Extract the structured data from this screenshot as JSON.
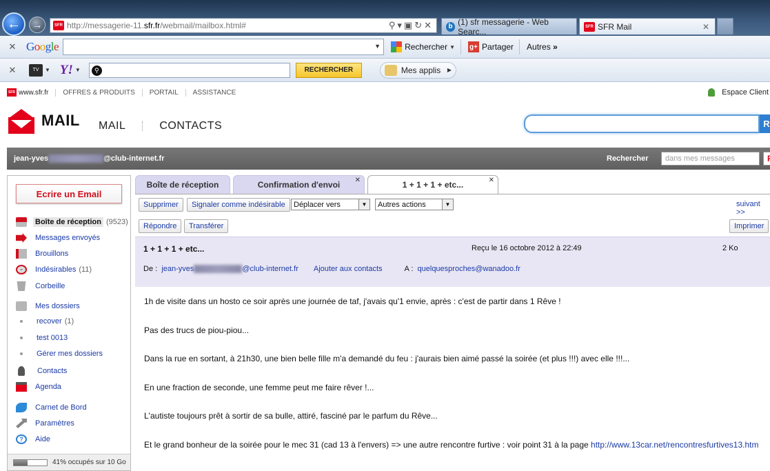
{
  "browser": {
    "url_prefix": "http://messagerie-11.",
    "url_domain": "sfr.fr",
    "url_suffix": "/webmail/mailbox.html#",
    "favicon_text": "SFR",
    "tabs": [
      {
        "label": "(1) sfr messagerie - Web Searc..."
      },
      {
        "label": "SFR Mail"
      }
    ]
  },
  "toolbar1": {
    "google_logo": [
      "G",
      "o",
      "o",
      "g",
      "l",
      "e"
    ],
    "search_btn": "Rechercher",
    "share_btn": "Partager",
    "more": "Autres"
  },
  "toolbar2": {
    "tv_label": "TV",
    "yahoo_logo": "Y!",
    "search_btn": "RECHERCHER",
    "apps_btn": "Mes applis"
  },
  "sfr_topnav": {
    "site": "www.sfr.fr",
    "links": [
      "OFFRES & PRODUITS",
      "PORTAIL",
      "ASSISTANCE"
    ],
    "espace_client": "Espace Client"
  },
  "header": {
    "brand": "MAIL",
    "nav": [
      "MAIL",
      "CONTACTS"
    ],
    "search_btn_letter": "R"
  },
  "userbar": {
    "email_start": "jean-yves",
    "email_domain": "@club-internet.fr",
    "search_label": "Rechercher",
    "search_placeholder": "dans mes messages",
    "search_btn": "P"
  },
  "sidebar": {
    "compose": "Ecrire un Email",
    "folders": [
      {
        "label": "Boîte de réception",
        "count": "(9523)",
        "icon": "inbox-icon"
      },
      {
        "label": "Messages envoyés",
        "count": "",
        "icon": "sent-icon"
      },
      {
        "label": "Brouillons",
        "count": "",
        "icon": "drafts-icon"
      },
      {
        "label": "Indésirables",
        "count": "(11)",
        "icon": "spam-icon"
      },
      {
        "label": "Corbeille",
        "count": "",
        "icon": "trash-icon"
      },
      {
        "label": "Mes dossiers",
        "count": "",
        "icon": "folder-icon"
      },
      {
        "label": "recover",
        "count": "(1)",
        "icon": "bullet"
      },
      {
        "label": "test 0013",
        "count": "",
        "icon": "bullet"
      },
      {
        "label": "Gérer mes dossiers",
        "count": "",
        "icon": "bullet"
      },
      {
        "label": "Contacts",
        "count": "",
        "icon": "contacts-icon"
      },
      {
        "label": "Agenda",
        "count": "",
        "icon": "calendar-icon"
      },
      {
        "label": "Carnet de Bord",
        "count": "",
        "icon": "feather-icon"
      },
      {
        "label": "Paramètres",
        "count": "",
        "icon": "wrench-icon"
      },
      {
        "label": "Aide",
        "count": "",
        "icon": "help-icon",
        "glyph": "?"
      }
    ],
    "storage": {
      "text": "41% occupés sur 10 Go",
      "fraction": 0.41
    }
  },
  "mail_tabs": [
    {
      "label": "Boîte de réception",
      "closable": false
    },
    {
      "label": "Confirmation d'envoi",
      "closable": true
    },
    {
      "label": "1 + 1 + 1 + etc...",
      "closable": true
    }
  ],
  "actions": {
    "delete": "Supprimer",
    "report_spam": "Signaler comme indésirable",
    "move": "Déplacer vers",
    "other": "Autres actions",
    "next": "suivant >>",
    "reply": "Répondre",
    "forward": "Transférer",
    "print": "Imprimer"
  },
  "message": {
    "subject": "1 + 1 + 1 + etc...",
    "received": "Reçu le 16 octobre 2012 à 22:49",
    "size": "2 Ko",
    "from_label": "De :",
    "from_start": "jean-yves",
    "from_domain": "@club-internet.fr",
    "add_contact": "Ajouter aux contacts",
    "to_label": "A :",
    "to": "quelquesproches@wanadoo.fr",
    "body": [
      "1h de visite dans un hosto ce soir après une journée de taf, j'avais qu'1 envie, après : c'est de partir dans 1 Rêve !",
      "Pas des trucs de piou-piou...",
      "Dans la rue en sortant, à 21h30, une bien belle fille m'a demandé du feu : j'aurais bien aimé passé la soirée (et plus !!!) avec elle !!!...",
      "En une fraction de seconde, une femme peut me faire rêver !...",
      "L'autiste toujours prêt à sortir de sa bulle, attiré, fasciné par le parfum du Rêve...",
      "Et le grand bonheur de la soirée pour le mec 31 (cad 13 à l'envers)  => une autre rencontre furtive : voir point  31 à la page "
    ],
    "body_url": "http://www.13car.net/rencontresfurtives13.htm"
  },
  "colors": {
    "sfr_red": "#e2001a",
    "link_blue": "#1a3aa6",
    "tab_lavender": "#dad7f0"
  }
}
